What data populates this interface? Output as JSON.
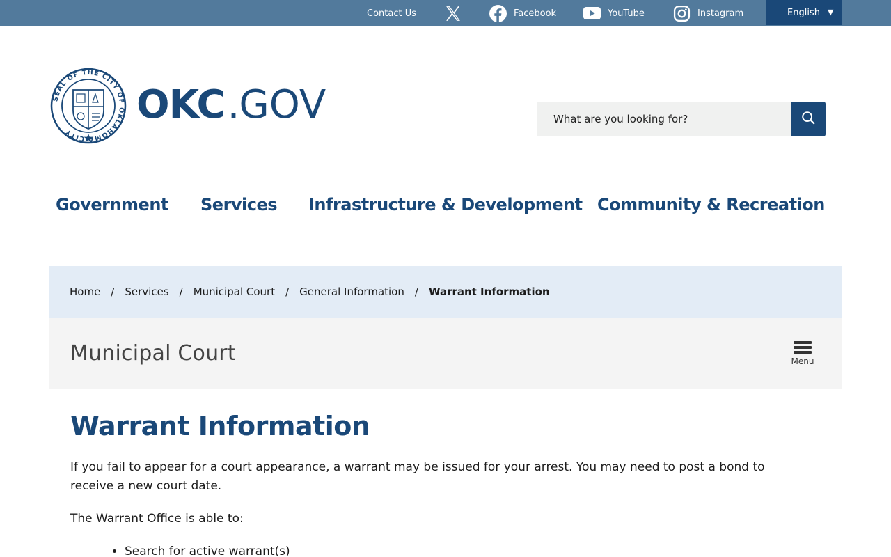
{
  "topbar": {
    "contact_label": "Contact Us",
    "facebook_label": "Facebook",
    "youtube_label": "YouTube",
    "instagram_label": "Instagram",
    "language_label": "English",
    "language_caret": "▼",
    "colors": {
      "bar": "#527a9c",
      "language_bg": "#1a4878"
    }
  },
  "header": {
    "brand_primary": "OKC",
    "brand_dot": ".",
    "brand_secondary": "GOV",
    "seal_text": "SEAL OF THE CITY OF OKLAHOMA CITY",
    "seal_icon": "city-seal-icon",
    "search_placeholder": "What are you looking for?",
    "search_icon": "search-icon"
  },
  "nav": {
    "items": [
      {
        "label": "Government"
      },
      {
        "label": "Services"
      },
      {
        "label": "Infrastructure & Development"
      },
      {
        "label": "Community & Recreation"
      }
    ]
  },
  "breadcrumb": {
    "items": [
      "Home",
      "Services",
      "Municipal Court",
      "General Information",
      "Warrant Information"
    ],
    "separator": "/"
  },
  "section": {
    "title": "Municipal Court",
    "menu_label": "Menu",
    "menu_icon": "hamburger-menu-icon"
  },
  "content": {
    "heading": "Warrant Information",
    "paragraph_1": "If you fail to appear for a court appearance, a warrant may be issued for your arrest. You may need to post a bond to receive a new court date.",
    "paragraph_2": "The Warrant Office is able to:",
    "list": [
      "Search for active warrant(s)"
    ]
  },
  "colors": {
    "brand_blue": "#1a4878",
    "breadcrumb_bg": "#e3ecf6",
    "section_bg": "#f4f4f4",
    "search_bg": "#f0f1f0"
  }
}
